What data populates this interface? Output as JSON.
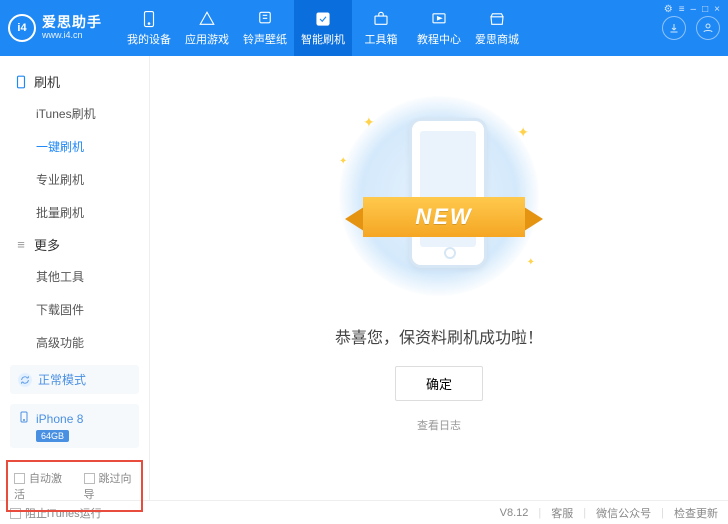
{
  "app": {
    "name": "爱思助手",
    "url": "www.i4.cn",
    "logo_text": "i4"
  },
  "window_controls": {
    "settings": "⚙",
    "grid": "≡",
    "min": "–",
    "max": "□",
    "close": "×"
  },
  "nav": [
    {
      "id": "device",
      "label": "我的设备"
    },
    {
      "id": "apps",
      "label": "应用游戏"
    },
    {
      "id": "ringtone",
      "label": "铃声壁纸"
    },
    {
      "id": "flash",
      "label": "智能刷机"
    },
    {
      "id": "toolbox",
      "label": "工具箱"
    },
    {
      "id": "tutorial",
      "label": "教程中心"
    },
    {
      "id": "store",
      "label": "爱思商城"
    }
  ],
  "nav_active_index": 3,
  "sidebar": {
    "groups": [
      {
        "title": "刷机",
        "items": [
          "iTunes刷机",
          "一键刷机",
          "专业刷机",
          "批量刷机"
        ],
        "active_index": 1
      },
      {
        "title": "更多",
        "items": [
          "其他工具",
          "下载固件",
          "高级功能"
        ],
        "active_index": -1
      }
    ],
    "mode": "正常模式",
    "device": {
      "name": "iPhone 8",
      "storage": "64GB"
    },
    "options": {
      "auto_activate": "自动激活",
      "skip_guide": "跳过向导"
    }
  },
  "main": {
    "ribbon_text": "NEW",
    "message": "恭喜您，保资料刷机成功啦！",
    "ok": "确定",
    "view_log": "查看日志"
  },
  "footer": {
    "block_itunes": "阻止iTunes运行",
    "version": "V8.12",
    "support": "客服",
    "wechat": "微信公众号",
    "update": "检查更新"
  }
}
